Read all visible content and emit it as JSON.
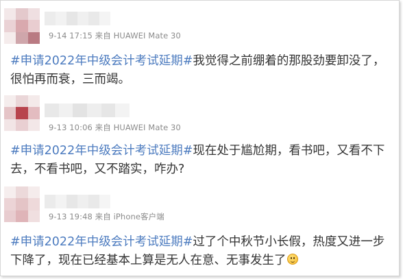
{
  "posts": [
    {
      "meta": "9-14 17:15 来自 HUAWEI Mate 30",
      "hashtag": "#申请2022年中级会计考试延期#",
      "line1": "我觉得之前绷着的那股劲要卸没了，",
      "line2": "很怕再而衰，三而竭。"
    },
    {
      "meta": "9-13 10:06 来自 HUAWEI Mate 30",
      "hashtag": "#申请2022年中级会计考试延期#",
      "line1": "现在处于尴尬期，看书吧，又看不下",
      "line2": "去，不看书吧，又不踏实，咋办?"
    },
    {
      "meta": "9-13 19:48 来自 iPhone客户端",
      "hashtag": "#申请2022年中级会计考试延期#",
      "line1": "过了个中秋节小长假，热度又进一步",
      "line2": "下降了，现在已经基本上算是无人在意、无事发生了"
    }
  ],
  "icons": {
    "emoji": "grinning-face-emoji"
  }
}
